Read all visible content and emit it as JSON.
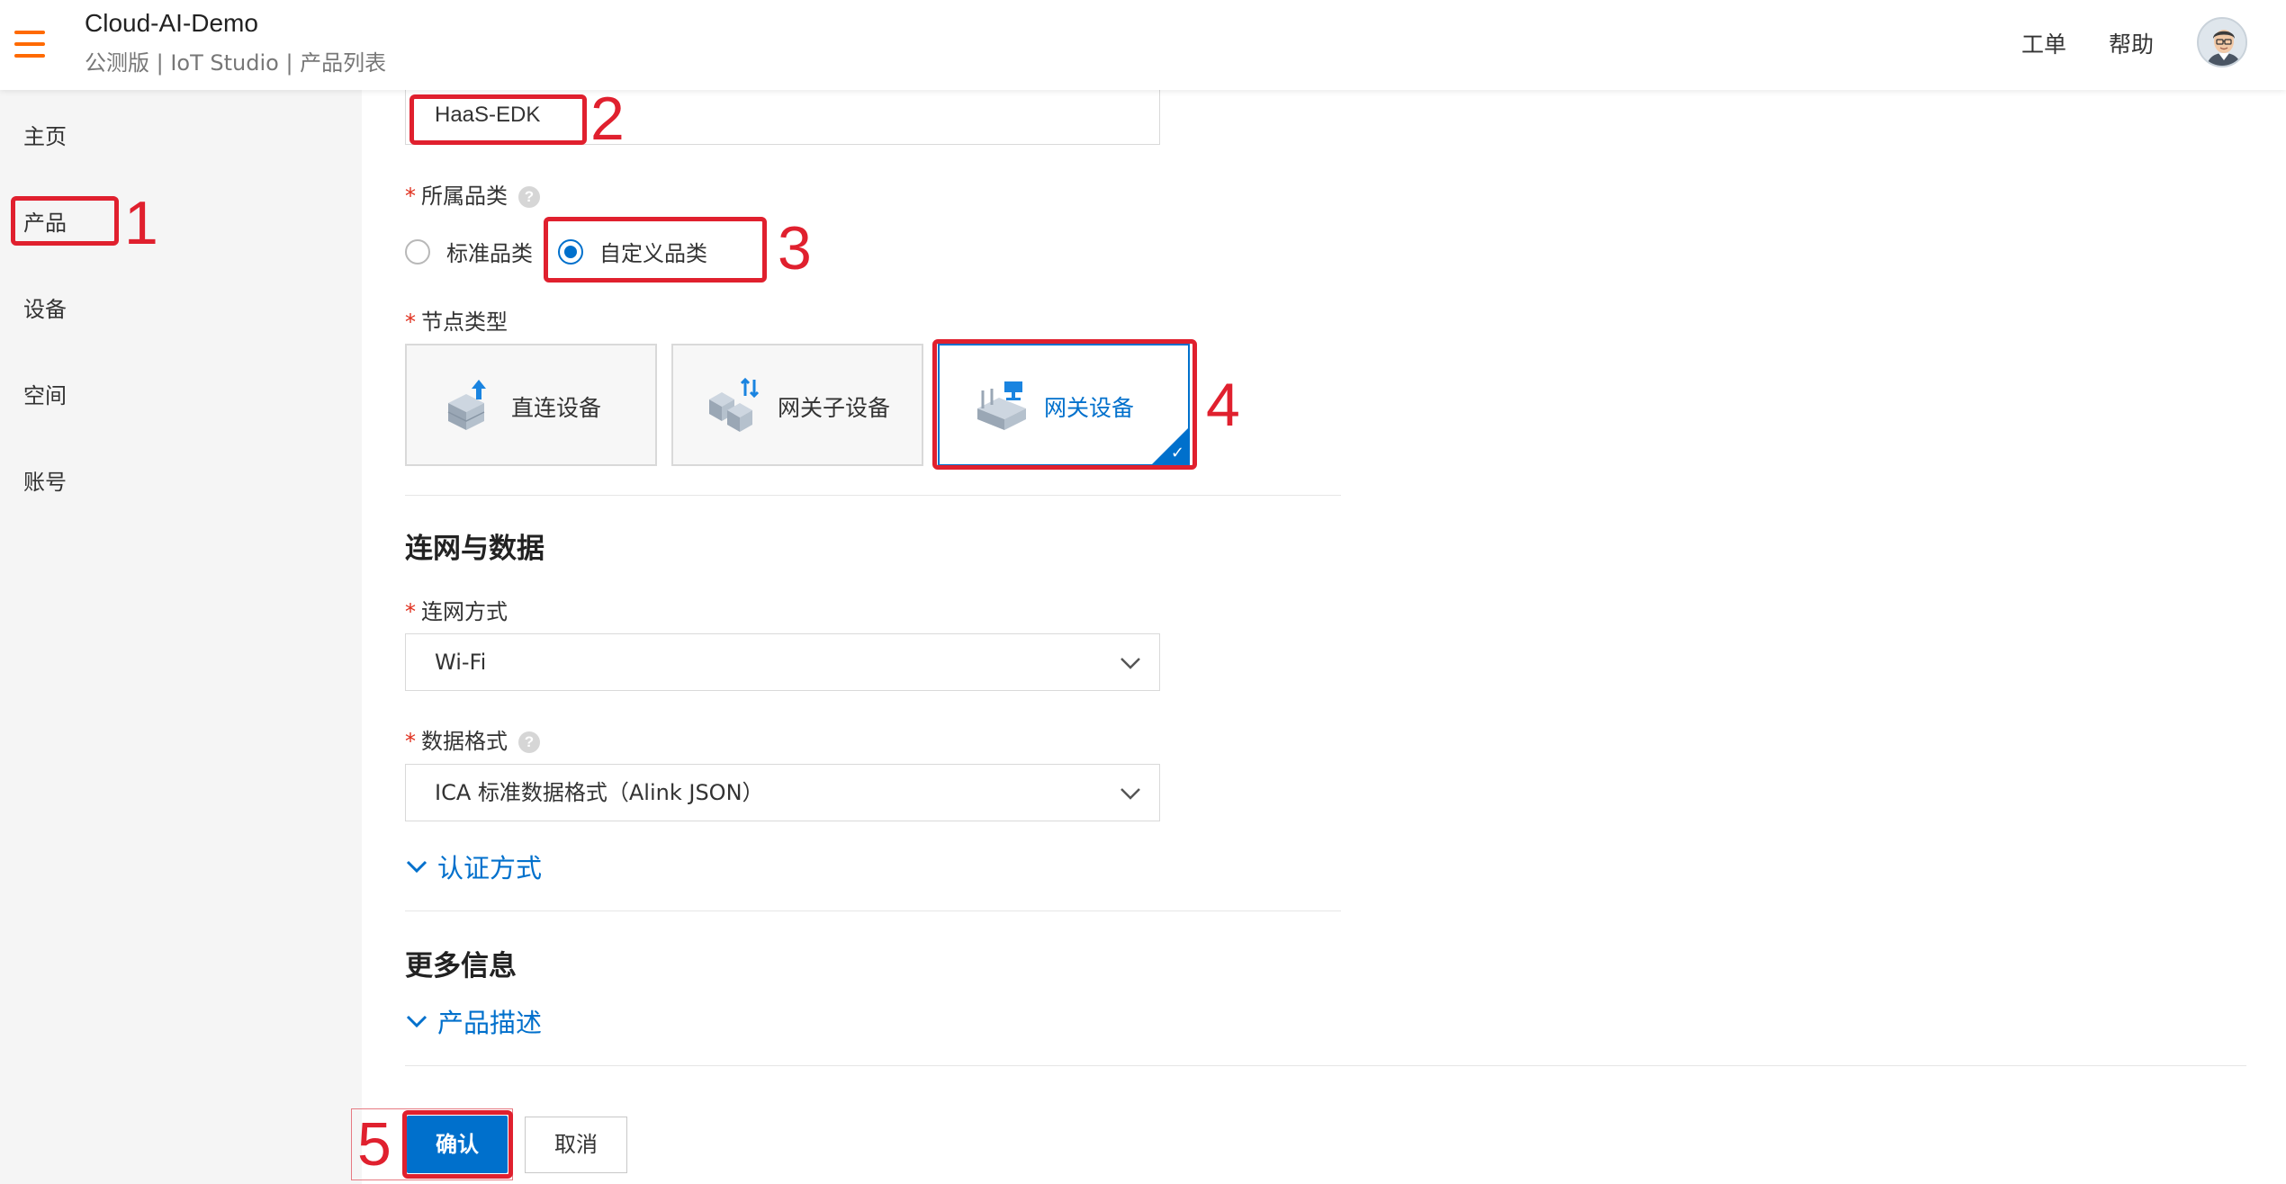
{
  "header": {
    "app_title": "Cloud-AI-Demo",
    "breadcrumb": "公测版 | IoT Studio | 产品列表",
    "links": [
      "工单",
      "帮助"
    ]
  },
  "sidebar": {
    "items": [
      {
        "label": "主页"
      },
      {
        "label": "产品"
      },
      {
        "label": "设备"
      },
      {
        "label": "空间"
      },
      {
        "label": "账号"
      }
    ]
  },
  "form": {
    "product_name_value": "HaaS-EDK",
    "category": {
      "label": "所属品类",
      "options": [
        "标准品类",
        "自定义品类"
      ],
      "selected": "自定义品类"
    },
    "node_type": {
      "label": "节点类型",
      "options": [
        "直连设备",
        "网关子设备",
        "网关设备"
      ],
      "selected": "网关设备"
    },
    "network_section_title": "连网与数据",
    "network_method": {
      "label": "连网方式",
      "value": "Wi-Fi"
    },
    "data_format": {
      "label": "数据格式",
      "value": "ICA 标准数据格式（Alink JSON）"
    },
    "auth_collapse": "认证方式",
    "more_section_title": "更多信息",
    "desc_collapse": "产品描述",
    "confirm_label": "确认",
    "cancel_label": "取消"
  },
  "annotations": [
    "1",
    "2",
    "3",
    "4",
    "5"
  ],
  "colors": {
    "accent": "#0070cc",
    "brand_orange": "#ff6a00",
    "annotation_red": "#e0202e",
    "required_star": "#e0301e"
  }
}
